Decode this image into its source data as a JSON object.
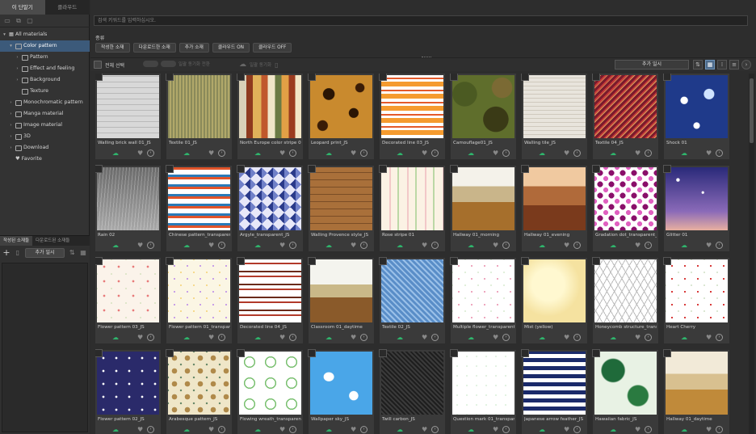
{
  "top_tabs": [
    "이 단말기",
    "클라우드"
  ],
  "tree": [
    {
      "label": "All materials",
      "level": 0,
      "arrow": "▾",
      "icon": "grid"
    },
    {
      "label": "Color pattern",
      "level": 1,
      "arrow": "▾",
      "icon": "folder",
      "selected": true
    },
    {
      "label": "Pattern",
      "level": 2,
      "arrow": "›",
      "icon": "folder"
    },
    {
      "label": "Effect and feeling",
      "level": 2,
      "arrow": "›",
      "icon": "folder"
    },
    {
      "label": "Background",
      "level": 2,
      "arrow": "›",
      "icon": "folder"
    },
    {
      "label": "Texture",
      "level": 2,
      "arrow": "",
      "icon": "folder"
    },
    {
      "label": "Monochromatic pattern",
      "level": 1,
      "arrow": "›",
      "icon": "folder"
    },
    {
      "label": "Manga material",
      "level": 1,
      "arrow": "›",
      "icon": "folder"
    },
    {
      "label": "Image material",
      "level": 1,
      "arrow": "›",
      "icon": "folder"
    },
    {
      "label": "3D",
      "level": 1,
      "arrow": "›",
      "icon": "folder"
    },
    {
      "label": "Download",
      "level": 1,
      "arrow": "›",
      "icon": "folder"
    },
    {
      "label": "Favorite",
      "level": 1,
      "arrow": "",
      "icon": "heart"
    }
  ],
  "tag_panel": {
    "tabs": [
      "작성된 소재들",
      "다운로드된 소재들"
    ],
    "add_button": "추가 일시"
  },
  "search_placeholder": "검색 키워드를 입력하십시오.",
  "filter_label": "종류",
  "filters": [
    "작성한 소재",
    "다운로드한 소재",
    "추가 소재",
    "클라우드 ON",
    "클라우드 OFF"
  ],
  "action_bar": {
    "select_all": "전체 선택",
    "sync_label": "일괄 동기화 전환",
    "sync2_label": "일괄 동기화",
    "sort": "추가 일시"
  },
  "materials": [
    {
      "name": "Walling brick wall 01_JS",
      "pattern": "brick"
    },
    {
      "name": "Textile 01_JS",
      "pattern": "textile1"
    },
    {
      "name": "North Europe color stripe 02_JS",
      "pattern": "stripes"
    },
    {
      "name": "Leopard print_JS",
      "pattern": "leopard"
    },
    {
      "name": "Decorated line 03_JS",
      "pattern": "deco3"
    },
    {
      "name": "Camouflage01_JS",
      "pattern": "camo"
    },
    {
      "name": "Walling tile_JS",
      "pattern": "tile"
    },
    {
      "name": "Textile 04_JS",
      "pattern": "textile4"
    },
    {
      "name": "Shock 01",
      "pattern": "shock"
    },
    {
      "name": "Rain 02",
      "pattern": "rain"
    },
    {
      "name": "Chinese pattern_transparent_JS",
      "pattern": "chinese"
    },
    {
      "name": "Argyle_transparent_JS",
      "pattern": "argyle"
    },
    {
      "name": "Walling Provence style_JS",
      "pattern": "provence"
    },
    {
      "name": "Rose stripe 01",
      "pattern": "rosestripe"
    },
    {
      "name": "Hallway 01_morning",
      "pattern": "hall_morning"
    },
    {
      "name": "Hallway 01_evening",
      "pattern": "hall_evening"
    },
    {
      "name": "Gradation dot_transparent_JS",
      "pattern": "dots"
    },
    {
      "name": "Glitter 01",
      "pattern": "glitter"
    },
    {
      "name": "Flower pattern 03_JS",
      "pattern": "flower3"
    },
    {
      "name": "Flower pattern 01_transparent_JS",
      "pattern": "flower1"
    },
    {
      "name": "Decorated line 04_JS",
      "pattern": "deco4"
    },
    {
      "name": "Classroom 01_daytime",
      "pattern": "classroom"
    },
    {
      "name": "Textile 02_JS",
      "pattern": "textile2"
    },
    {
      "name": "Multiple flower_transparent_JS",
      "pattern": "multiflower"
    },
    {
      "name": "Mist (yellow)",
      "pattern": "mist"
    },
    {
      "name": "Honeycomb structure_transparent",
      "pattern": "honeycomb"
    },
    {
      "name": "Heart Cherry",
      "pattern": "heart"
    },
    {
      "name": "Flower pattern 02_JS",
      "pattern": "flower2"
    },
    {
      "name": "Arabesque pattern_JS",
      "pattern": "arabesque"
    },
    {
      "name": "Flowing wreath_transparent_JS",
      "pattern": "wreath"
    },
    {
      "name": "Wallpaper sky_JS",
      "pattern": "sky"
    },
    {
      "name": "Twill carbon_JS",
      "pattern": "carbon"
    },
    {
      "name": "Question mark 01_transparent",
      "pattern": "question"
    },
    {
      "name": "Japanese arrow feather_JS",
      "pattern": "arrow"
    },
    {
      "name": "Hawaiian fabric_JS",
      "pattern": "hawaii"
    },
    {
      "name": "Hallway 01_daytime",
      "pattern": "hall_day"
    }
  ]
}
